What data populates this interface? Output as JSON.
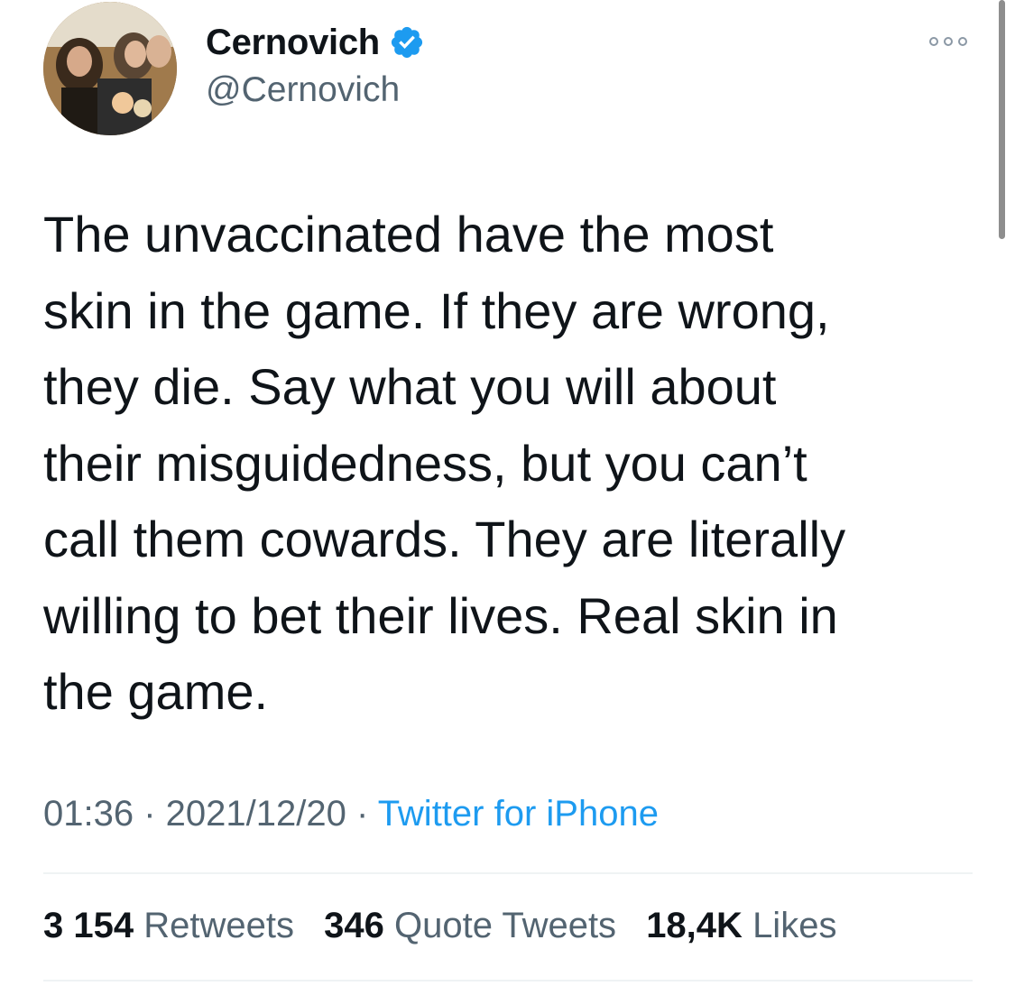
{
  "author": {
    "display_name": "Cernovich",
    "handle": "@Cernovich",
    "verified": true,
    "avatar_icon": "profile-photo"
  },
  "menu_icon": "more-options-icon",
  "tweet": {
    "text": "The unvaccinated have the most\nskin in the game. If they are wrong,\nthey die. Say what you will about\ntheir misguidedness, but you can’t\ncall them cowards. They are literally\nwilling to bet their lives. Real skin in\nthe game."
  },
  "meta": {
    "time": "01:36",
    "separator": " · ",
    "date": "2021/12/20",
    "source": "Twitter for iPhone"
  },
  "stats": {
    "retweets_count": "3 154",
    "retweets_label": "Retweets",
    "quotes_count": "346",
    "quotes_label": "Quote Tweets",
    "likes_count": "18,4K",
    "likes_label": "Likes"
  },
  "colors": {
    "accent": "#1d9bf0",
    "secondary_text": "#536471",
    "primary_text": "#0f1419",
    "divider": "#eff3f4"
  }
}
